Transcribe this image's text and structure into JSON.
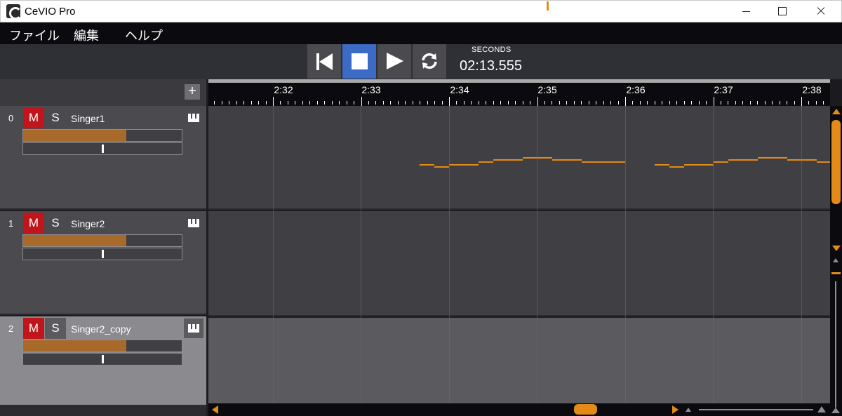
{
  "window": {
    "title": "CeVIO Pro"
  },
  "menu": {
    "items": [
      "ファイル",
      "編集",
      "ヘルプ"
    ]
  },
  "transport": {
    "time_label": "SECONDS",
    "time_value": "02:13.555",
    "buttons": [
      "rewind-icon",
      "stop-icon",
      "play-icon",
      "loop-icon"
    ],
    "active_button": "stop",
    "accent_color": "#3b6bc4"
  },
  "track_panel": {
    "add_label": "+"
  },
  "tracks": [
    {
      "index": "0",
      "mute_label": "M",
      "solo_label": "S",
      "name": "Singer1",
      "volume": 0.65,
      "pan": 0.5,
      "selected": false
    },
    {
      "index": "1",
      "mute_label": "M",
      "solo_label": "S",
      "name": "Singer2",
      "volume": 0.65,
      "pan": 0.5,
      "selected": false
    },
    {
      "index": "2",
      "mute_label": "M",
      "solo_label": "S",
      "name": "Singer2_copy",
      "volume": 0.65,
      "pan": 0.5,
      "selected": true
    }
  ],
  "timeline": {
    "tick_labels": [
      "2:32",
      "2:33",
      "2:34",
      "2:35",
      "2:36",
      "2:37",
      "2:38"
    ],
    "accent_color": "#e38b16",
    "mute_color": "#c0161b",
    "volume_fill_color": "#a86a2a"
  }
}
